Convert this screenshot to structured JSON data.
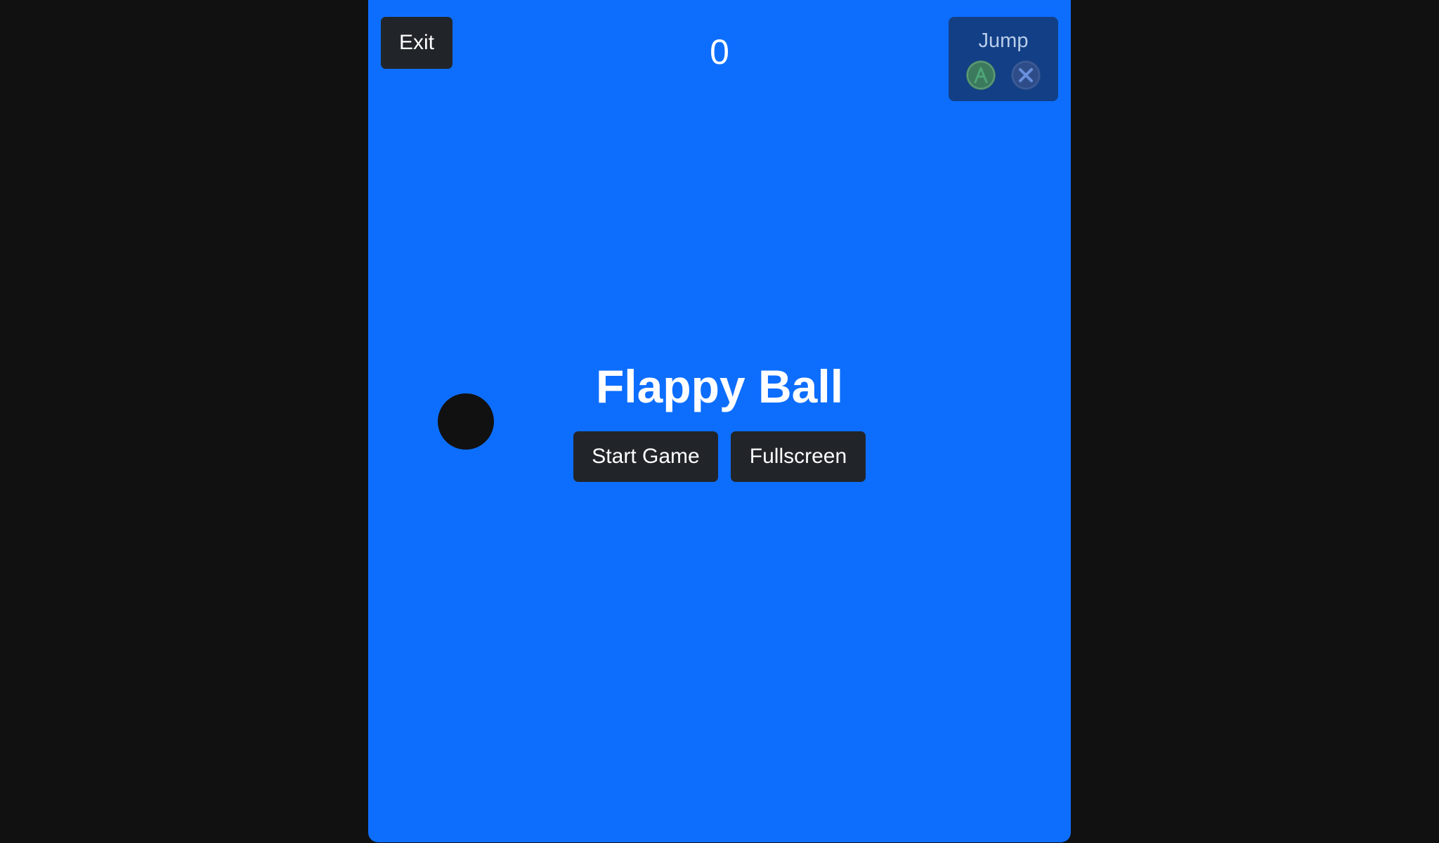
{
  "header": {
    "exit_label": "Exit",
    "score": "0"
  },
  "controls": {
    "jump_label": "Jump",
    "icons": [
      "gamepad-a-button-icon",
      "gamepad-x-button-icon"
    ]
  },
  "menu": {
    "title": "Flappy Ball",
    "start_label": "Start Game",
    "fullscreen_label": "Fullscreen"
  },
  "colors": {
    "background": "#111111",
    "stage": "#0d6efd",
    "button": "#212529",
    "ball": "#111111",
    "jump_panel": "#123f86",
    "a_button": "#3c7a5d",
    "x_button": "#2e4d88"
  }
}
